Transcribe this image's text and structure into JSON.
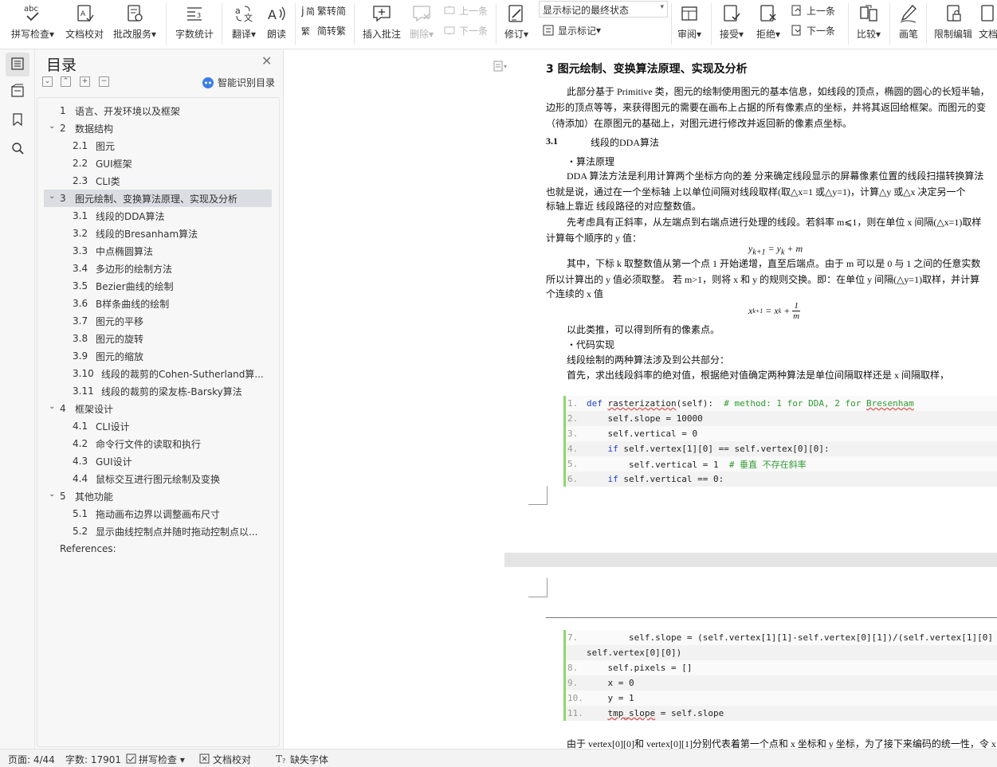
{
  "ribbon": {
    "buttons": [
      {
        "label": "拼写检查",
        "icon": "spellcheck-icon",
        "dropdown": true
      },
      {
        "label": "文档校对",
        "icon": "proofread-icon",
        "dropdown": false
      },
      {
        "label": "批改服务",
        "icon": "correction-service-icon",
        "dropdown": true
      },
      {
        "label": "字数统计",
        "icon": "word-count-icon",
        "dropdown": false
      },
      {
        "label": "翻译",
        "icon": "translate-icon",
        "dropdown": true
      },
      {
        "label": "朗读",
        "icon": "read-aloud-icon",
        "dropdown": false
      },
      {
        "label": "插入批注",
        "icon": "insert-comment-icon",
        "dropdown": false
      },
      {
        "label": "删除",
        "icon": "delete-comment-icon",
        "dropdown": true,
        "disabled": true
      },
      {
        "label": "修订",
        "icon": "track-changes-icon",
        "dropdown": true
      },
      {
        "label": "审阅",
        "icon": "review-icon",
        "dropdown": true
      },
      {
        "label": "接受",
        "icon": "accept-icon",
        "dropdown": true
      },
      {
        "label": "拒绝",
        "icon": "reject-icon",
        "dropdown": true
      },
      {
        "label": "比较",
        "icon": "compare-icon",
        "dropdown": true
      },
      {
        "label": "画笔",
        "icon": "pen-icon",
        "dropdown": false
      },
      {
        "label": "限制编辑",
        "icon": "restrict-edit-icon",
        "dropdown": false
      },
      {
        "label": "文档",
        "icon": "document-icon",
        "dropdown": false
      }
    ],
    "trad_simp": "繁转简",
    "simp_trad": "简转繁",
    "prev_comment": "上一条",
    "next_comment": "下一条",
    "show_mark_select": "显示标记的最终状态",
    "show_marks": "显示标记",
    "prev_change": "上一条",
    "next_change": "下一条"
  },
  "toc": {
    "title": "目录",
    "smart_label": "智能识别目录",
    "items": [
      {
        "num": "1",
        "text": "语言、开发环境以及框架",
        "level": 1,
        "arrow": ""
      },
      {
        "num": "2",
        "text": "数据结构",
        "level": 1,
        "arrow": "⌄"
      },
      {
        "num": "2.1",
        "text": "图元",
        "level": 2,
        "arrow": ""
      },
      {
        "num": "2.2",
        "text": "GUI框架",
        "level": 2,
        "arrow": ""
      },
      {
        "num": "2.3",
        "text": "CLI类",
        "level": 2,
        "arrow": ""
      },
      {
        "num": "3",
        "text": "图元绘制、变换算法原理、实现及分析",
        "level": 1,
        "arrow": "⌄",
        "selected": true
      },
      {
        "num": "3.1",
        "text": "线段的DDA算法",
        "level": 2,
        "arrow": ""
      },
      {
        "num": "3.2",
        "text": "线段的Bresanham算法",
        "level": 2,
        "arrow": ""
      },
      {
        "num": "3.3",
        "text": "中点椭圆算法",
        "level": 2,
        "arrow": ""
      },
      {
        "num": "3.4",
        "text": "多边形的绘制方法",
        "level": 2,
        "arrow": ""
      },
      {
        "num": "3.5",
        "text": "Bezier曲线的绘制",
        "level": 2,
        "arrow": ""
      },
      {
        "num": "3.6",
        "text": "B样条曲线的绘制",
        "level": 2,
        "arrow": ""
      },
      {
        "num": "3.7",
        "text": "图元的平移",
        "level": 2,
        "arrow": ""
      },
      {
        "num": "3.8",
        "text": "图元的旋转",
        "level": 2,
        "arrow": ""
      },
      {
        "num": "3.9",
        "text": "图元的缩放",
        "level": 2,
        "arrow": ""
      },
      {
        "num": "3.10",
        "text": "线段的裁剪的Cohen-Sutherland算...",
        "level": 2,
        "arrow": ""
      },
      {
        "num": "3.11",
        "text": "线段的裁剪的梁友栋-Barsky算法",
        "level": 2,
        "arrow": ""
      },
      {
        "num": "4",
        "text": "框架设计",
        "level": 1,
        "arrow": "⌄"
      },
      {
        "num": "4.1",
        "text": "CLI设计",
        "level": 2,
        "arrow": ""
      },
      {
        "num": "4.2",
        "text": "命令行文件的读取和执行",
        "level": 2,
        "arrow": ""
      },
      {
        "num": "4.3",
        "text": "GUI设计",
        "level": 2,
        "arrow": ""
      },
      {
        "num": "4.4",
        "text": "鼠标交互进行图元绘制及变换",
        "level": 2,
        "arrow": ""
      },
      {
        "num": "5",
        "text": "其他功能",
        "level": 1,
        "arrow": "⌄"
      },
      {
        "num": "5.1",
        "text": "拖动画布边界以调整画布尺寸",
        "level": 2,
        "arrow": ""
      },
      {
        "num": "5.2",
        "text": "显示曲线控制点并随时拖动控制点以...",
        "level": 2,
        "arrow": ""
      },
      {
        "num": "",
        "text": "References:",
        "level": 0,
        "arrow": ""
      }
    ]
  },
  "doc": {
    "heading": "3    图元绘制、变换算法原理、实现及分析",
    "para1": [
      "此部分基于 Primitive 类，图元的绘制使用图元的基本信息，如线段的顶点，椭圆的圆心的长短半轴，",
      "边形的顶点等等，来获得图元的需要在画布上占据的所有像素点的坐标，并将其返回给框架。而图元的变",
      "（待添加）在原图元的基础上，对图元进行修改并返回新的像素点坐标。"
    ],
    "sub_heading_num": "3.1",
    "sub_heading_text": "线段的DDA算法",
    "bullet1": "・算法原理",
    "para2": [
      "DDA 算法方法是利用计算两个坐标方向的差  分来确定线段显示的屏幕像素位置的线段扫描转换算法",
      "也就是说，通过在一个坐标轴  上以单位间隔对线段取样(取△x=1 或△y=1)，计算△y 或△x 决定另一个",
      "标轴上靠近  线段路径的对应整数值。"
    ],
    "para3": [
      "先考虑具有正斜率，从左端点到右端点进行处理的线段。若斜率  m⩽1，则在单位  x 间隔(△x=1)取样",
      "计算每个顺序的  y 值："
    ],
    "formula1": "y<sub>k+1</sub> = y<sub>k</sub> + m",
    "para4": [
      "其中，下标 k 取整数值从第一个点  1  开始递增，直至后端点。由于  m  可以是 0 与 1 之间的任意实数",
      "所以计算出的 y 值必须取整。  若  m>1，则将 x 和 y 的规则交换。即：在单位 y 间隔(△y=1)取样，并计算",
      "个连续的  x  值"
    ],
    "formula2_left": "x",
    "formula2_sub": "k+1",
    "formula2_mid": "= x",
    "formula2_sub2": "k",
    "formula2_plus": "+",
    "formula2_num": "1",
    "formula2_den": "m",
    "para5": "以此类推，可以得到所有的像素点。",
    "bullet2": "・代码实现",
    "para6": "线段绘制的两种算法涉及到公共部分：",
    "para7": "首先，求出线段斜率的绝对值，根据绝对值确定两种算法是单位间隔取样还是 x 间隔取样，",
    "code1": [
      {
        "n": "1.",
        "html": "<span class='kw'>def</span> <span class='squig'>rasterization</span>(self):  <span class='cm'># method: 1 for DDA, 2 for <span class='squig'>Bresenham</span></span>"
      },
      {
        "n": "2.",
        "html": "    self.slope = 10000"
      },
      {
        "n": "3.",
        "html": "    self.vertical = 0"
      },
      {
        "n": "4.",
        "html": "    <span class='kw'>if</span> self.vertex[1][0] == self.vertex[0][0]:"
      },
      {
        "n": "5.",
        "html": "        self.vertical = 1  <span class='cm'># 垂直 不存在斜率</span>"
      },
      {
        "n": "6.",
        "html": "    <span class='kw'>if</span> self.vertical == 0:"
      }
    ],
    "code2": [
      {
        "n": "7.",
        "html": "        self.slope = (self.vertex[1][1]-self.vertex[0][1])/(self.vertex[1][0]"
      },
      {
        "n": "",
        "html": "self.vertex[0][0])"
      },
      {
        "n": "8.",
        "html": "    self.pixels = []"
      },
      {
        "n": "9.",
        "html": "    x = 0"
      },
      {
        "n": "10.",
        "html": "    y = 1"
      },
      {
        "n": "11.",
        "html": "    <span class='squig'>tmp_slope</span> = self.slope"
      }
    ],
    "para8": "由于 vertex[0][0]和 vertex[0][1]分别代表着第一个点和 x 坐标和 y 坐标，为了接下来编码的统一性，令 x"
  },
  "status": {
    "page": "页面: 4/44",
    "words": "字数: 17901",
    "spellcheck": "拼写检查",
    "proofread": "文档校对",
    "missing_font": "缺失字体"
  }
}
